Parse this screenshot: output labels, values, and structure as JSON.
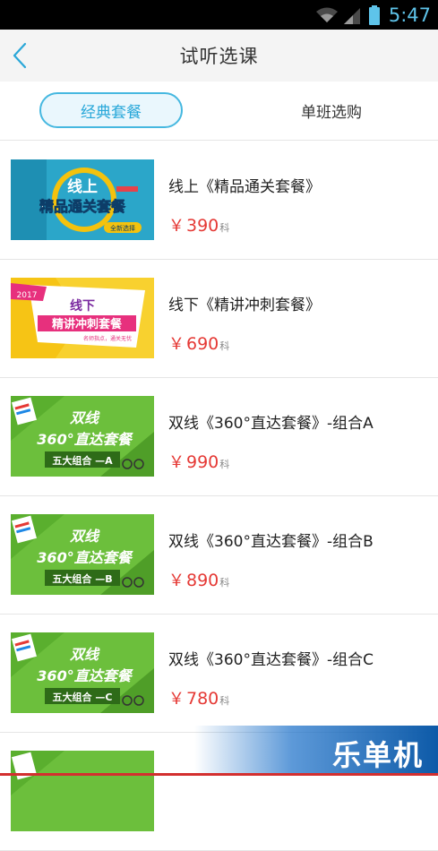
{
  "status": {
    "time": "5:47"
  },
  "header": {
    "title": "试听选课"
  },
  "tabs": [
    {
      "label": "经典套餐"
    },
    {
      "label": "单班选购"
    }
  ],
  "items": [
    {
      "name": "线上《精品通关套餐》",
      "price": "390",
      "unit": "科",
      "banner": [
        "线上",
        "精品通关套餐",
        "全新选择"
      ]
    },
    {
      "name": "线下《精讲冲刺套餐》",
      "price": "690",
      "unit": "科",
      "banner": [
        "2017",
        "线下",
        "精讲冲刺套餐",
        "名师指点，通关无忧"
      ]
    },
    {
      "name": "双线《360°直达套餐》-组合A",
      "price": "990",
      "unit": "科",
      "banner": [
        "双线",
        "360°直达套餐",
        "五大组合 —A"
      ]
    },
    {
      "name": "双线《360°直达套餐》-组合B",
      "price": "890",
      "unit": "科",
      "banner": [
        "双线",
        "360°直达套餐",
        "五大组合 —B"
      ]
    },
    {
      "name": "双线《360°直达套餐》-组合C",
      "price": "780",
      "unit": "科",
      "banner": [
        "双线",
        "360°直达套餐",
        "五大组合 —C"
      ]
    }
  ],
  "currency": "￥",
  "watermark": "乐单机"
}
